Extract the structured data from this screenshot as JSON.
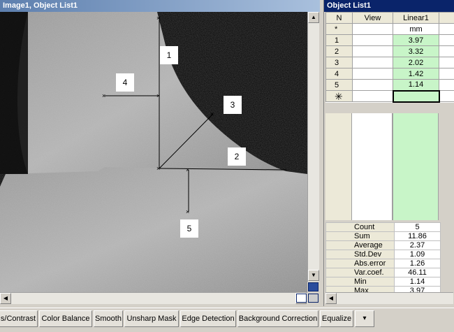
{
  "image_window": {
    "title": "Image1, Object List1",
    "labels": [
      "1",
      "2",
      "3",
      "4",
      "5"
    ]
  },
  "object_list": {
    "title": "Object List1",
    "headers": {
      "n": "N",
      "view": "View",
      "linear": "Linear1"
    },
    "units_row": {
      "n": "*",
      "unit": "mm"
    },
    "rows": [
      {
        "n": "1",
        "value": "3.97"
      },
      {
        "n": "2",
        "value": "3.32"
      },
      {
        "n": "3",
        "value": "2.02"
      },
      {
        "n": "4",
        "value": "1.42"
      },
      {
        "n": "5",
        "value": "1.14"
      }
    ],
    "new_row_symbol": "✳",
    "stats": [
      {
        "label": "Count",
        "value": "5"
      },
      {
        "label": "Sum",
        "value": "11.86"
      },
      {
        "label": "Average",
        "value": "2.37"
      },
      {
        "label": "Std.Dev",
        "value": "1.09"
      },
      {
        "label": "Abs.error",
        "value": "1.26"
      },
      {
        "label": "Var.coef.",
        "value": "46.11"
      },
      {
        "label": "Min",
        "value": "1.14"
      },
      {
        "label": "Max",
        "value": "3.97"
      }
    ]
  },
  "toolbar": {
    "buttons": [
      "s/Contrast",
      "Color Balance",
      "Smooth",
      "Unsharp Mask",
      "Edge Detection",
      "Background Correction",
      "Equalize"
    ],
    "more": "▾"
  },
  "colors": {
    "value_green": "#c8f5c8",
    "title_blue": "#0a246a"
  }
}
